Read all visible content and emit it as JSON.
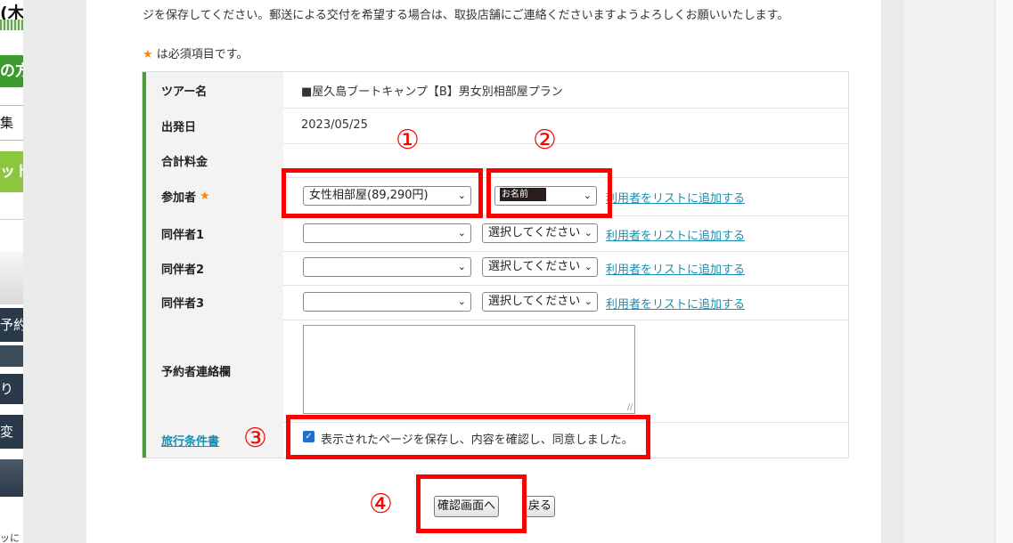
{
  "sidebar": {
    "items": [
      "(木",
      "の方",
      "集",
      "ット",
      "予約",
      "り",
      "変",
      "ッに"
    ]
  },
  "intro_text": "ジを保存してください。郵送による交付を希望する場合は、取扱店舗にご連絡くださいますようよろしくお願いいたします。",
  "required_note": {
    "star": "★",
    "text": " は必須項目です。"
  },
  "form": {
    "tour_label": "ツアー名",
    "tour_value": "■屋久島ブートキャンプ【B】男女別相部屋プラン",
    "date_label": "出発日",
    "date_value": "2023/05/25",
    "total_label": "合計料金",
    "participant_label": "参加者",
    "participant_star": "★",
    "participant_room": "女性相部屋(89,290円)",
    "participant_name": "お名前",
    "add_user_link": "利用者をリストに追加する",
    "companions": [
      {
        "label": "同伴者1",
        "room": "",
        "name": "選択してください"
      },
      {
        "label": "同伴者2",
        "room": "",
        "name": "選択してください"
      },
      {
        "label": "同伴者3",
        "room": "",
        "name": "選択してください"
      }
    ],
    "contact_label": "予約者連絡欄",
    "contact_value": "",
    "terms_link": "旅行条件書",
    "agree_label": "表示されたページを保存し、内容を確認し、同意しました。",
    "agree_checked": true
  },
  "buttons": {
    "confirm": "確認画面へ",
    "back": "戻る"
  },
  "annotations": {
    "n1": "①",
    "n2": "②",
    "n3": "③",
    "n4": "④",
    "color": "#ff0000"
  },
  "icons": {
    "chevron": "chevron-down-icon",
    "check": "check-icon"
  }
}
